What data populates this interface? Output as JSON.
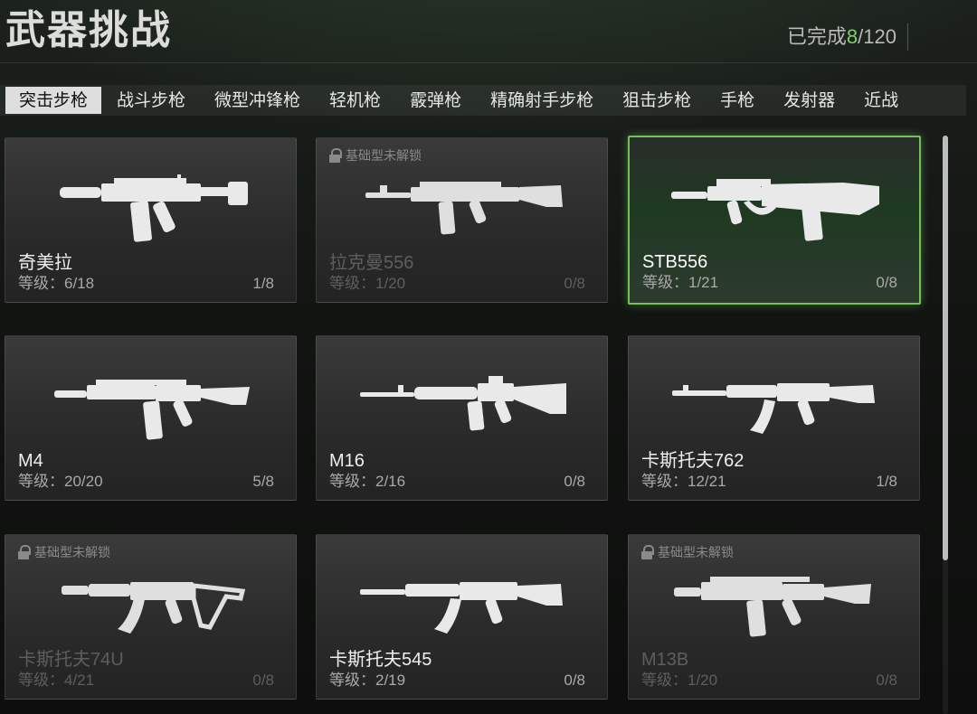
{
  "header": {
    "title": "武器挑战",
    "progress_label": "已完成",
    "progress_done": "8",
    "progress_total": "/120"
  },
  "tabs": [
    {
      "label": "突击步枪",
      "active": true
    },
    {
      "label": "战斗步枪"
    },
    {
      "label": "微型冲锋枪"
    },
    {
      "label": "轻机枪"
    },
    {
      "label": "霰弹枪"
    },
    {
      "label": "精确射手步枪"
    },
    {
      "label": "狙击步枪"
    },
    {
      "label": "手枪"
    },
    {
      "label": "发射器"
    },
    {
      "label": "近战"
    }
  ],
  "lock_text": "基础型未解锁",
  "colors": {
    "accent": "#6fc25c",
    "progress_done": "#7fd06a"
  },
  "weapons": [
    {
      "name": "奇美拉",
      "level": "等级：6/18",
      "count": "1/8",
      "locked": false,
      "selected": false,
      "icon": "smg-compact-rifle"
    },
    {
      "name": "拉克曼556",
      "level": "等级：1/20",
      "count": "0/8",
      "locked": true,
      "selected": false,
      "icon": "battle-rifle"
    },
    {
      "name": "STB556",
      "level": "等级：1/21",
      "count": "0/8",
      "locked": false,
      "selected": true,
      "icon": "bullpup-rifle"
    },
    {
      "name": "M4",
      "level": "等级：20/20",
      "count": "5/8",
      "locked": false,
      "selected": false,
      "icon": "carbine-rifle"
    },
    {
      "name": "M16",
      "level": "等级：2/16",
      "count": "0/8",
      "locked": false,
      "selected": false,
      "icon": "classic-rifle"
    },
    {
      "name": "卡斯托夫762",
      "level": "等级：12/21",
      "count": "1/8",
      "locked": false,
      "selected": false,
      "icon": "ak-rifle"
    },
    {
      "name": "卡斯托夫74U",
      "level": "等级：4/21",
      "count": "0/8",
      "locked": true,
      "selected": false,
      "icon": "ak-short-rifle"
    },
    {
      "name": "卡斯托夫545",
      "level": "等级：2/19",
      "count": "0/8",
      "locked": false,
      "selected": false,
      "icon": "ak-rifle"
    },
    {
      "name": "M13B",
      "level": "等级：1/20",
      "count": "0/8",
      "locked": true,
      "selected": false,
      "icon": "carbine-rifle"
    }
  ]
}
